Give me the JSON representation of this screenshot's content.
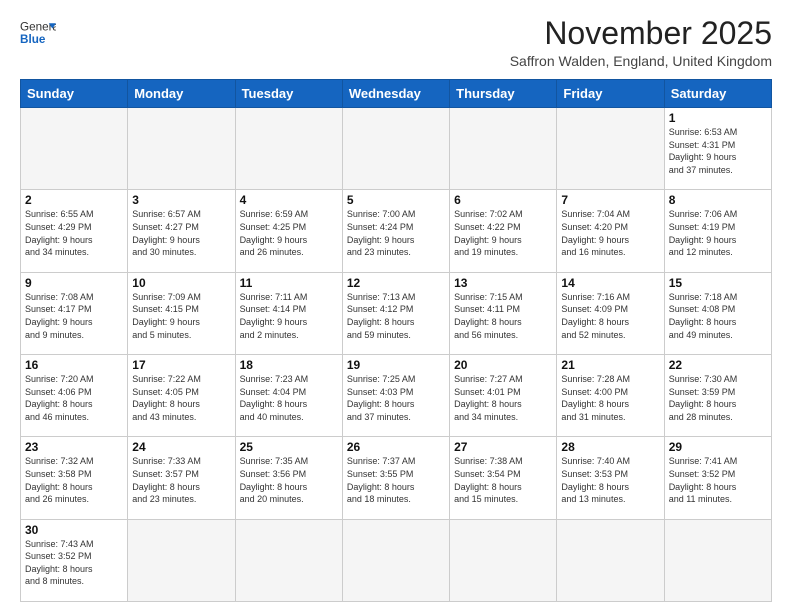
{
  "header": {
    "logo": {
      "general": "General",
      "blue": "Blue"
    },
    "title": "November 2025",
    "location": "Saffron Walden, England, United Kingdom"
  },
  "days_of_week": [
    "Sunday",
    "Monday",
    "Tuesday",
    "Wednesday",
    "Thursday",
    "Friday",
    "Saturday"
  ],
  "weeks": [
    [
      {
        "day": "",
        "info": ""
      },
      {
        "day": "",
        "info": ""
      },
      {
        "day": "",
        "info": ""
      },
      {
        "day": "",
        "info": ""
      },
      {
        "day": "",
        "info": ""
      },
      {
        "day": "",
        "info": ""
      },
      {
        "day": "1",
        "info": "Sunrise: 6:53 AM\nSunset: 4:31 PM\nDaylight: 9 hours\nand 37 minutes."
      }
    ],
    [
      {
        "day": "2",
        "info": "Sunrise: 6:55 AM\nSunset: 4:29 PM\nDaylight: 9 hours\nand 34 minutes."
      },
      {
        "day": "3",
        "info": "Sunrise: 6:57 AM\nSunset: 4:27 PM\nDaylight: 9 hours\nand 30 minutes."
      },
      {
        "day": "4",
        "info": "Sunrise: 6:59 AM\nSunset: 4:25 PM\nDaylight: 9 hours\nand 26 minutes."
      },
      {
        "day": "5",
        "info": "Sunrise: 7:00 AM\nSunset: 4:24 PM\nDaylight: 9 hours\nand 23 minutes."
      },
      {
        "day": "6",
        "info": "Sunrise: 7:02 AM\nSunset: 4:22 PM\nDaylight: 9 hours\nand 19 minutes."
      },
      {
        "day": "7",
        "info": "Sunrise: 7:04 AM\nSunset: 4:20 PM\nDaylight: 9 hours\nand 16 minutes."
      },
      {
        "day": "8",
        "info": "Sunrise: 7:06 AM\nSunset: 4:19 PM\nDaylight: 9 hours\nand 12 minutes."
      }
    ],
    [
      {
        "day": "9",
        "info": "Sunrise: 7:08 AM\nSunset: 4:17 PM\nDaylight: 9 hours\nand 9 minutes."
      },
      {
        "day": "10",
        "info": "Sunrise: 7:09 AM\nSunset: 4:15 PM\nDaylight: 9 hours\nand 5 minutes."
      },
      {
        "day": "11",
        "info": "Sunrise: 7:11 AM\nSunset: 4:14 PM\nDaylight: 9 hours\nand 2 minutes."
      },
      {
        "day": "12",
        "info": "Sunrise: 7:13 AM\nSunset: 4:12 PM\nDaylight: 8 hours\nand 59 minutes."
      },
      {
        "day": "13",
        "info": "Sunrise: 7:15 AM\nSunset: 4:11 PM\nDaylight: 8 hours\nand 56 minutes."
      },
      {
        "day": "14",
        "info": "Sunrise: 7:16 AM\nSunset: 4:09 PM\nDaylight: 8 hours\nand 52 minutes."
      },
      {
        "day": "15",
        "info": "Sunrise: 7:18 AM\nSunset: 4:08 PM\nDaylight: 8 hours\nand 49 minutes."
      }
    ],
    [
      {
        "day": "16",
        "info": "Sunrise: 7:20 AM\nSunset: 4:06 PM\nDaylight: 8 hours\nand 46 minutes."
      },
      {
        "day": "17",
        "info": "Sunrise: 7:22 AM\nSunset: 4:05 PM\nDaylight: 8 hours\nand 43 minutes."
      },
      {
        "day": "18",
        "info": "Sunrise: 7:23 AM\nSunset: 4:04 PM\nDaylight: 8 hours\nand 40 minutes."
      },
      {
        "day": "19",
        "info": "Sunrise: 7:25 AM\nSunset: 4:03 PM\nDaylight: 8 hours\nand 37 minutes."
      },
      {
        "day": "20",
        "info": "Sunrise: 7:27 AM\nSunset: 4:01 PM\nDaylight: 8 hours\nand 34 minutes."
      },
      {
        "day": "21",
        "info": "Sunrise: 7:28 AM\nSunset: 4:00 PM\nDaylight: 8 hours\nand 31 minutes."
      },
      {
        "day": "22",
        "info": "Sunrise: 7:30 AM\nSunset: 3:59 PM\nDaylight: 8 hours\nand 28 minutes."
      }
    ],
    [
      {
        "day": "23",
        "info": "Sunrise: 7:32 AM\nSunset: 3:58 PM\nDaylight: 8 hours\nand 26 minutes."
      },
      {
        "day": "24",
        "info": "Sunrise: 7:33 AM\nSunset: 3:57 PM\nDaylight: 8 hours\nand 23 minutes."
      },
      {
        "day": "25",
        "info": "Sunrise: 7:35 AM\nSunset: 3:56 PM\nDaylight: 8 hours\nand 20 minutes."
      },
      {
        "day": "26",
        "info": "Sunrise: 7:37 AM\nSunset: 3:55 PM\nDaylight: 8 hours\nand 18 minutes."
      },
      {
        "day": "27",
        "info": "Sunrise: 7:38 AM\nSunset: 3:54 PM\nDaylight: 8 hours\nand 15 minutes."
      },
      {
        "day": "28",
        "info": "Sunrise: 7:40 AM\nSunset: 3:53 PM\nDaylight: 8 hours\nand 13 minutes."
      },
      {
        "day": "29",
        "info": "Sunrise: 7:41 AM\nSunset: 3:52 PM\nDaylight: 8 hours\nand 11 minutes."
      }
    ],
    [
      {
        "day": "30",
        "info": "Sunrise: 7:43 AM\nSunset: 3:52 PM\nDaylight: 8 hours\nand 8 minutes."
      },
      {
        "day": "",
        "info": ""
      },
      {
        "day": "",
        "info": ""
      },
      {
        "day": "",
        "info": ""
      },
      {
        "day": "",
        "info": ""
      },
      {
        "day": "",
        "info": ""
      },
      {
        "day": "",
        "info": ""
      }
    ]
  ]
}
